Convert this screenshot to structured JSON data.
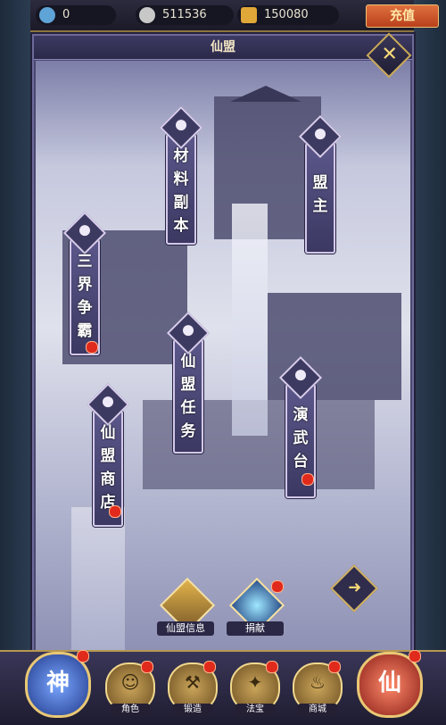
{
  "resources": {
    "gems": "0",
    "silver": "511536",
    "gold": "150080",
    "recharge_label": "充值"
  },
  "panel": {
    "title": "仙盟",
    "close_icon": "close-x-icon",
    "next_icon": "arrow-icon"
  },
  "banners": [
    {
      "id": "materials",
      "text": "材\n料\n副\n本",
      "has_dot": false
    },
    {
      "id": "leader",
      "text": "盟\n主",
      "has_dot": false
    },
    {
      "id": "three-realms",
      "text": "三\n界\n争\n霸",
      "has_dot": true
    },
    {
      "id": "quests",
      "text": "仙\n盟\n任\n务",
      "has_dot": false
    },
    {
      "id": "arena",
      "text": "演\n武\n台",
      "has_dot": true
    },
    {
      "id": "shop",
      "text": "仙\n盟\n商\n店",
      "has_dot": true
    }
  ],
  "feature_buttons": {
    "info": "仙盟信息",
    "donate": "捐献"
  },
  "bottom_nav": {
    "left_big": "神",
    "right_big": "仙",
    "items": [
      "角色",
      "锻造",
      "法宝",
      "商城"
    ]
  },
  "colors": {
    "notification": "#e02a1c",
    "gold_border": "#e9c875"
  }
}
